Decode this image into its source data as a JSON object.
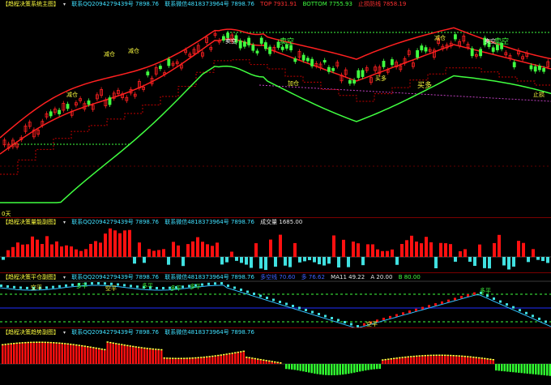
{
  "panes": {
    "main": {
      "title": "【趋程决策系统主图】",
      "contact_qq": "联系QQ2094279439号 7898.76",
      "contact_wx": "联系微信4818373964号 7898.76",
      "top_label": "TOP 7931.91",
      "bottom_label": "BOTTOM 7755.93",
      "trend_label": "止损防线 7858.19",
      "annotations": [
        {
          "text": "减仓",
          "color": "#ffff40"
        },
        {
          "text": "减仓",
          "color": "#ffff40"
        },
        {
          "text": "减仓",
          "color": "#ffff40"
        },
        {
          "text": "卖空",
          "color": "#ffffff"
        },
        {
          "text": "卖空",
          "color": "#40ff40"
        },
        {
          "text": "加仓",
          "color": "#ffff40"
        },
        {
          "text": "买多",
          "color": "#ffff40"
        },
        {
          "text": "买多",
          "color": "#ffff40"
        },
        {
          "text": "减仓",
          "color": "#ffff40"
        },
        {
          "text": "卖空",
          "color": "#ffffff"
        },
        {
          "text": "卖空",
          "color": "#40ff40"
        },
        {
          "text": "止损",
          "color": "#ffff40"
        }
      ],
      "corner_note": "0天"
    },
    "volume": {
      "title": "【趋程决策量能副图】",
      "contact_qq": "联系QQ2094279439号 7898.76",
      "contact_wx": "联系微信4818373964号 7898.76",
      "value_label": "成交量 1685.00"
    },
    "flat": {
      "title": "【趋程决策平仓副图】",
      "contact_qq": "联系QQ2094279439号 7898.76",
      "contact_wx": "联系微信4818373964号 7898.76",
      "line1_label": "多空线 70.60",
      "line2_label": "多 76.62",
      "ma_label": "MA11 49.22",
      "a_label": "A 20.00",
      "b_label": "B 80.00",
      "marks": [
        "空平",
        "多平",
        "空平",
        "多平",
        "多平",
        "多平",
        "空平",
        "多平"
      ]
    },
    "trend": {
      "title": "【趋程决策趋势副图】",
      "contact_qq": "联系QQ2094279439号 7898.76",
      "contact_wx": "联系微信4818373964号 7898.76"
    }
  },
  "colors": {
    "up": "#ff2020",
    "down": "#40e0e0",
    "upper_band": "#ff2020",
    "lower_band": "#40ff40",
    "mid_band": "#ff2020",
    "dashed_red": "#c00000",
    "dashed_green": "#40ff40",
    "hist_red": "#ff1010",
    "hist_green": "#30ff30",
    "hist_yellow": "#ffff40"
  }
}
